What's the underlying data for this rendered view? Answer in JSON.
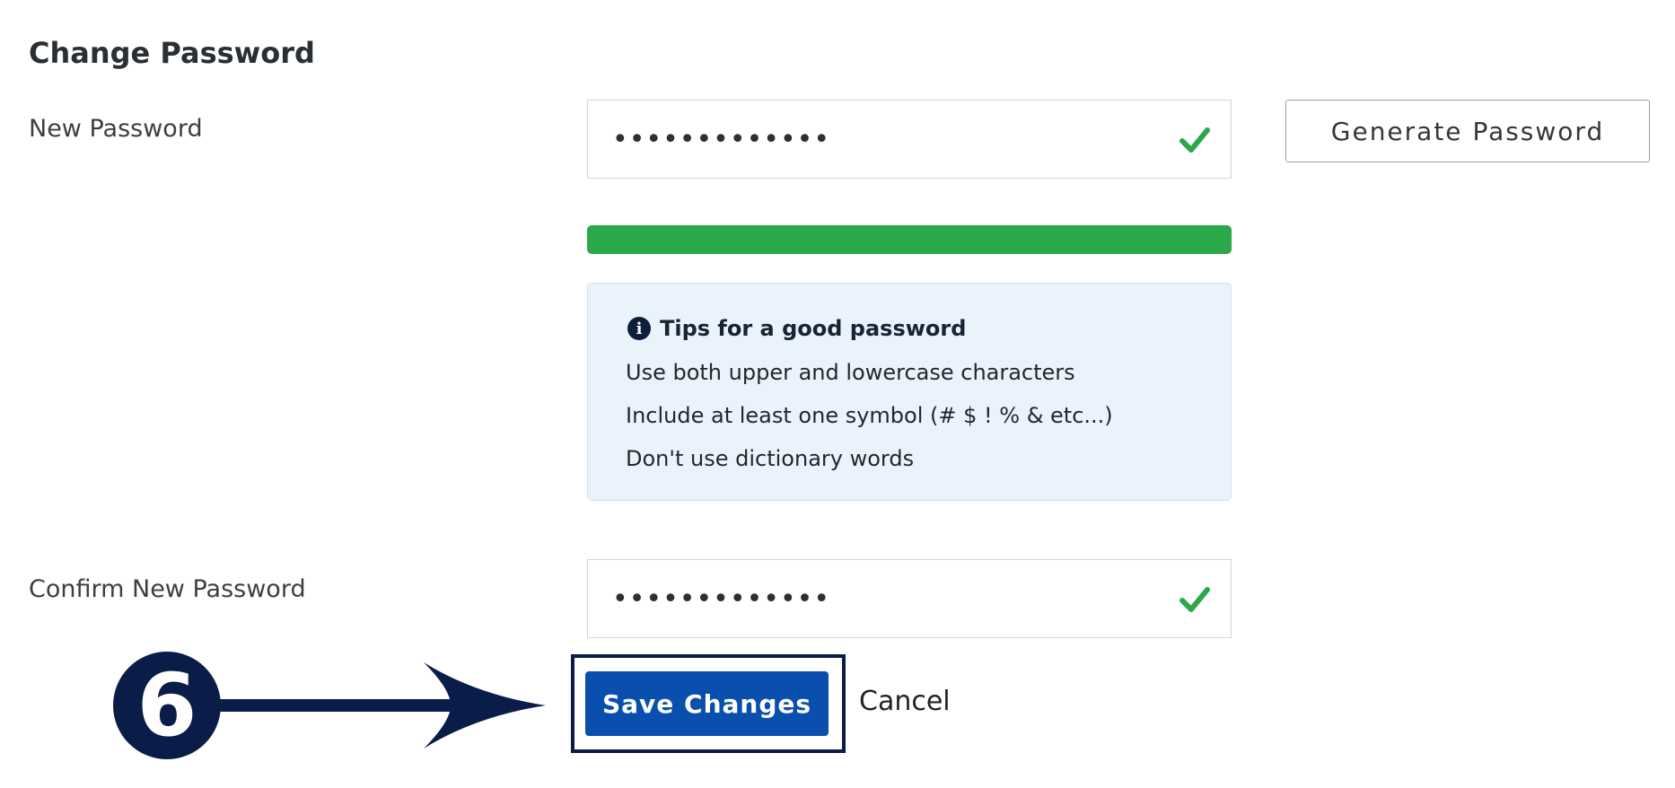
{
  "form": {
    "title": "Change Password",
    "new_password": {
      "label": "New Password",
      "value": "•••••••••••••",
      "valid": true
    },
    "generate_button_label": "Generate Password",
    "strength_fraction": 1.0,
    "tips": {
      "heading": "Tips for a good password",
      "items": [
        "Use both upper and lowercase characters",
        "Include at least one symbol (# $ ! % & etc...)",
        "Don't use dictionary words"
      ]
    },
    "confirm_password": {
      "label": "Confirm New Password",
      "value": "•••••••••••••",
      "valid": true
    },
    "save_button_label": "Save Changes",
    "cancel_label": "Cancel"
  },
  "annotation": {
    "step_number": "6"
  },
  "colors": {
    "success": "#2ba84a",
    "primary": "#0a4fae",
    "annotation": "#0a1d48",
    "tips_bg": "#eaf3fc"
  },
  "icons": {
    "valid": "check-icon",
    "info": "info-circle-icon"
  }
}
